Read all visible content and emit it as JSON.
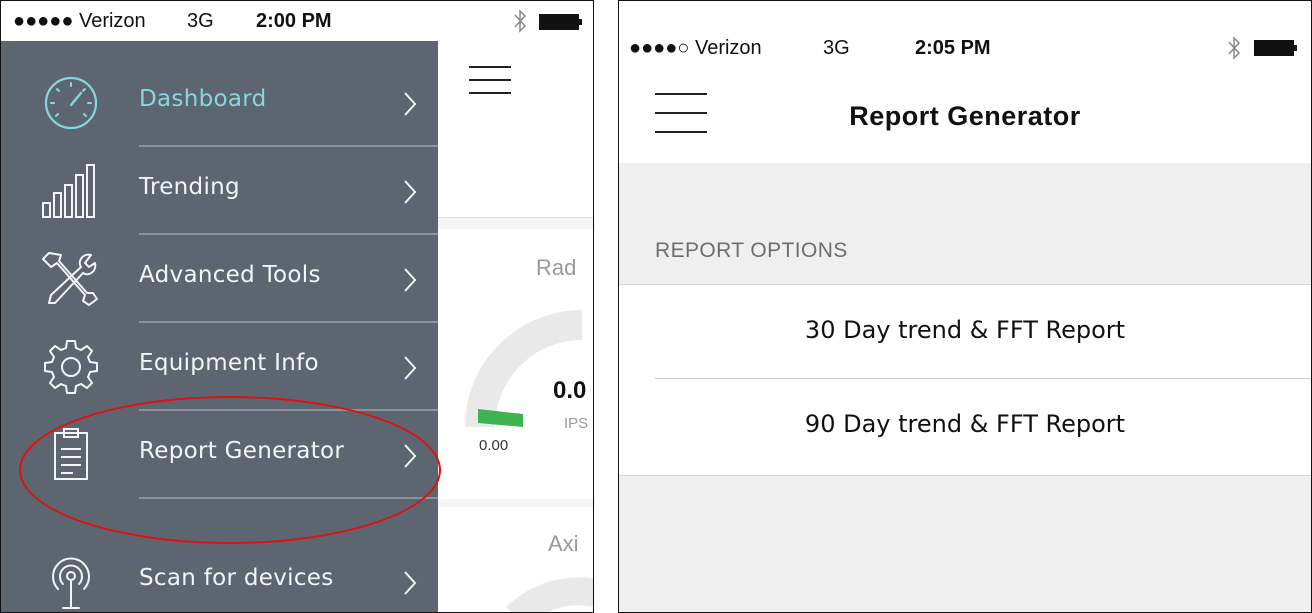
{
  "left": {
    "status_bar": {
      "carrier": "●●●●● Verizon",
      "network": "3G",
      "time": "2:00 PM"
    },
    "menu": {
      "items": [
        {
          "label": "Dashboard",
          "icon": "speedometer-icon",
          "active": true
        },
        {
          "label": "Trending",
          "icon": "bar-chart-icon",
          "active": false
        },
        {
          "label": "Advanced Tools",
          "icon": "tools-icon",
          "active": false
        },
        {
          "label": "Equipment Info",
          "icon": "gear-icon",
          "active": false
        },
        {
          "label": "Report Generator",
          "icon": "clipboard-icon",
          "active": false
        },
        {
          "label": "Scan for devices",
          "icon": "antenna-icon",
          "active": false
        }
      ]
    },
    "background_screen": {
      "gauge_title_1": "Rad",
      "gauge_value": "0.0",
      "gauge_unit": "IPS",
      "gauge_min": "0.00",
      "gauge_title_2": "Axi"
    },
    "highlight_color": "#e01010"
  },
  "right": {
    "status_bar": {
      "carrier": "●●●●○ Verizon",
      "network": "3G",
      "time": "2:05 PM"
    },
    "title": "Report Generator",
    "section_header": "REPORT OPTIONS",
    "options": [
      {
        "label": "30 Day trend & FFT Report"
      },
      {
        "label": "90 Day trend & FFT Report"
      }
    ]
  },
  "colors": {
    "menu_bg": "#5d6670",
    "menu_active": "#86d6e0",
    "gauge_green": "#3fb34f"
  }
}
